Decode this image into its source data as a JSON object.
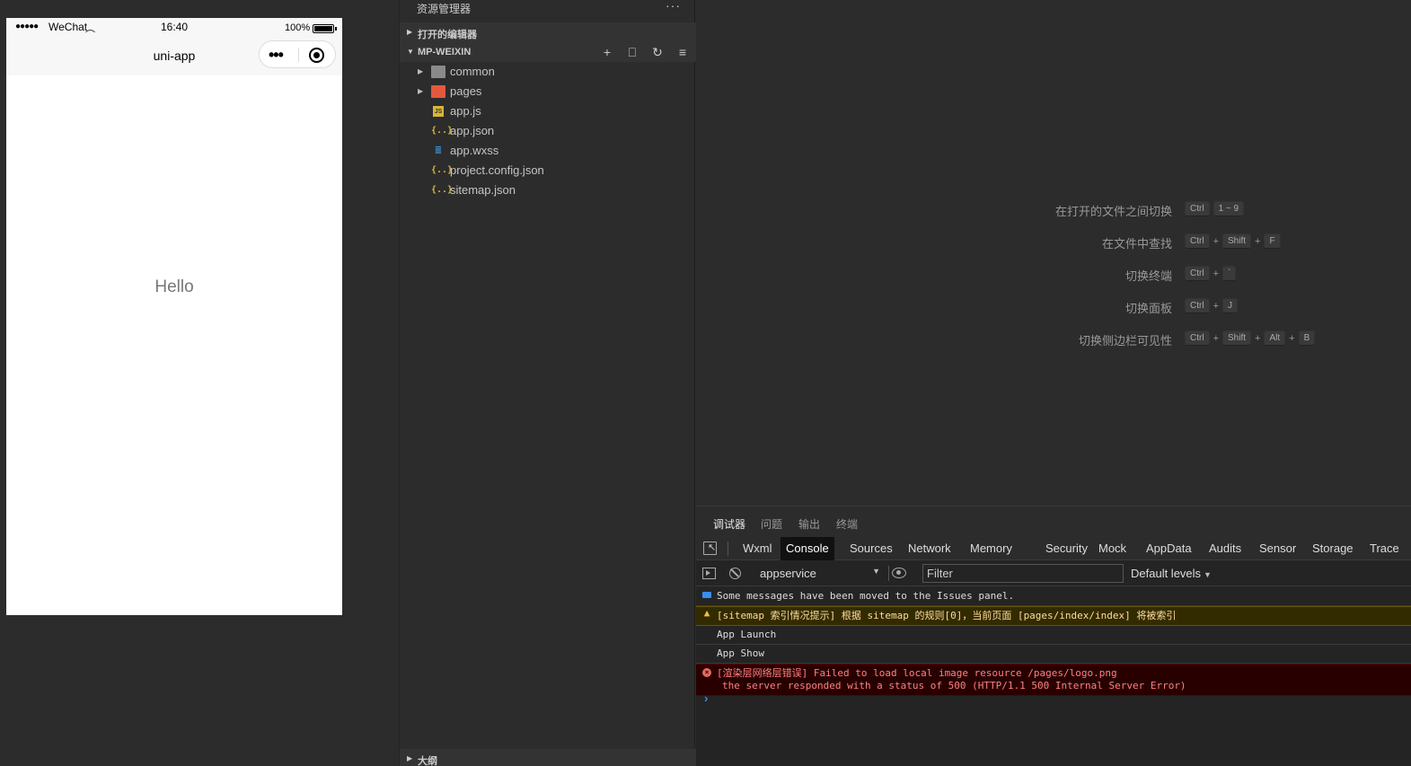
{
  "simulator": {
    "status": {
      "signal": "●●●●●",
      "carrier": "WeChat",
      "wifi": "☈",
      "time": "16:40",
      "battery_percent": "100%"
    },
    "nav_title": "uni-app",
    "capsule": {
      "more_glyph": "•••",
      "close_icon": "target-icon"
    },
    "page_text": "Hello"
  },
  "explorer": {
    "title": "资源管理器",
    "more": "···",
    "open_editors": "打开的编辑器",
    "project": "MP-WEIXIN",
    "tools": [
      {
        "icon": "new-file-icon",
        "glyph": "+"
      },
      {
        "icon": "new-folder-icon",
        "glyph": "⎕"
      },
      {
        "icon": "refresh-icon",
        "glyph": "↻"
      },
      {
        "icon": "collapse-all-icon",
        "glyph": "≡"
      }
    ],
    "items": [
      {
        "name": "common",
        "type": "folder",
        "icon_glyph": ""
      },
      {
        "name": "pages",
        "type": "folder-red",
        "icon_glyph": ""
      },
      {
        "name": "app.js",
        "type": "js",
        "icon_glyph": "JS"
      },
      {
        "name": "app.json",
        "type": "json",
        "icon_glyph": "{..}"
      },
      {
        "name": "app.wxss",
        "type": "css",
        "icon_glyph": "≣"
      },
      {
        "name": "project.config.json",
        "type": "json",
        "icon_glyph": "{..}"
      },
      {
        "name": "sitemap.json",
        "type": "json",
        "icon_glyph": "{..}"
      }
    ],
    "outline": "大纲"
  },
  "editor": {
    "shortcuts": [
      {
        "label": "在打开的文件之间切换",
        "keys": [
          "Ctrl",
          "1 ~ 9"
        ]
      },
      {
        "label": "在文件中查找",
        "keys": [
          "Ctrl",
          "+",
          "Shift",
          "+",
          "F"
        ]
      },
      {
        "label": "切换终端",
        "keys": [
          "Ctrl",
          "+",
          "`"
        ]
      },
      {
        "label": "切换面板",
        "keys": [
          "Ctrl",
          "+",
          "J"
        ]
      },
      {
        "label": "切换侧边栏可见性",
        "keys": [
          "Ctrl",
          "+",
          "Shift",
          "+",
          "Alt",
          "+",
          "B"
        ]
      }
    ]
  },
  "panel": {
    "tabs": [
      "调试器",
      "问题",
      "输出",
      "终端"
    ],
    "active_tab": "调试器"
  },
  "devtools": {
    "tabs": [
      "Wxml",
      "Console",
      "Sources",
      "Network",
      "Memory",
      "Security",
      "Mock",
      "AppData",
      "Audits",
      "Sensor",
      "Storage",
      "Trace"
    ],
    "active_tab": "Console",
    "context": "appservice",
    "filter_placeholder": "Filter",
    "levels": "Default levels",
    "messages": [
      {
        "level": "info",
        "text": "Some messages have been moved to the Issues panel."
      },
      {
        "level": "warn",
        "text": "[sitemap 索引情况提示] 根据 sitemap 的规则[0]，当前页面 [pages/index/index] 将被索引"
      },
      {
        "level": "log",
        "text": "App Launch"
      },
      {
        "level": "log",
        "text": "App Show"
      },
      {
        "level": "error",
        "text": "[渲染层网络层错误] Failed to load local image resource /pages/logo.png",
        "text2": "the server responded with a status of 500 (HTTP/1.1 500 Internal Server Error)"
      }
    ],
    "prompt": "›"
  },
  "colors": {
    "background": "#2c2c2c",
    "console_bg": "#242424",
    "warn_bg": "#332b00",
    "error_bg": "#290000",
    "accent_blue": "#3b8eea"
  }
}
